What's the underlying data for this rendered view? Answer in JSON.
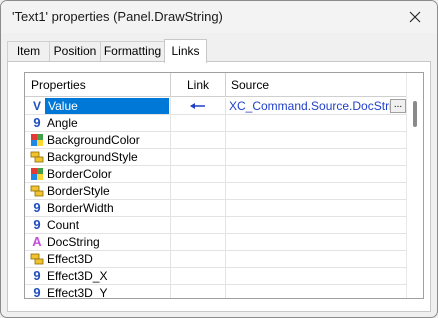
{
  "window": {
    "title": "'Text1' properties (Panel.DrawString)"
  },
  "tabs": [
    {
      "label": "Item"
    },
    {
      "label": "Position"
    },
    {
      "label": "Formatting"
    },
    {
      "label": "Links"
    }
  ],
  "grid": {
    "columns": [
      "Properties",
      "Link",
      "Source"
    ],
    "rows": [
      {
        "name": "Value",
        "icon": "v",
        "link": "arrow",
        "source": "XC_Command.Source.DocString"
      },
      {
        "name": "Angle",
        "icon": "9"
      },
      {
        "name": "BackgroundColor",
        "icon": "color"
      },
      {
        "name": "BackgroundStyle",
        "icon": "style"
      },
      {
        "name": "BorderColor",
        "icon": "color"
      },
      {
        "name": "BorderStyle",
        "icon": "style"
      },
      {
        "name": "BorderWidth",
        "icon": "9"
      },
      {
        "name": "Count",
        "icon": "9"
      },
      {
        "name": "DocString",
        "icon": "A"
      },
      {
        "name": "Effect3D",
        "icon": "style"
      },
      {
        "name": "Effect3D_X",
        "icon": "9"
      },
      {
        "name": "Effect3D_Y",
        "icon": "9"
      }
    ],
    "ellipsis_label": "..."
  },
  "colors": {
    "selection": "#0078d7",
    "source_link": "#1f3fc8"
  }
}
